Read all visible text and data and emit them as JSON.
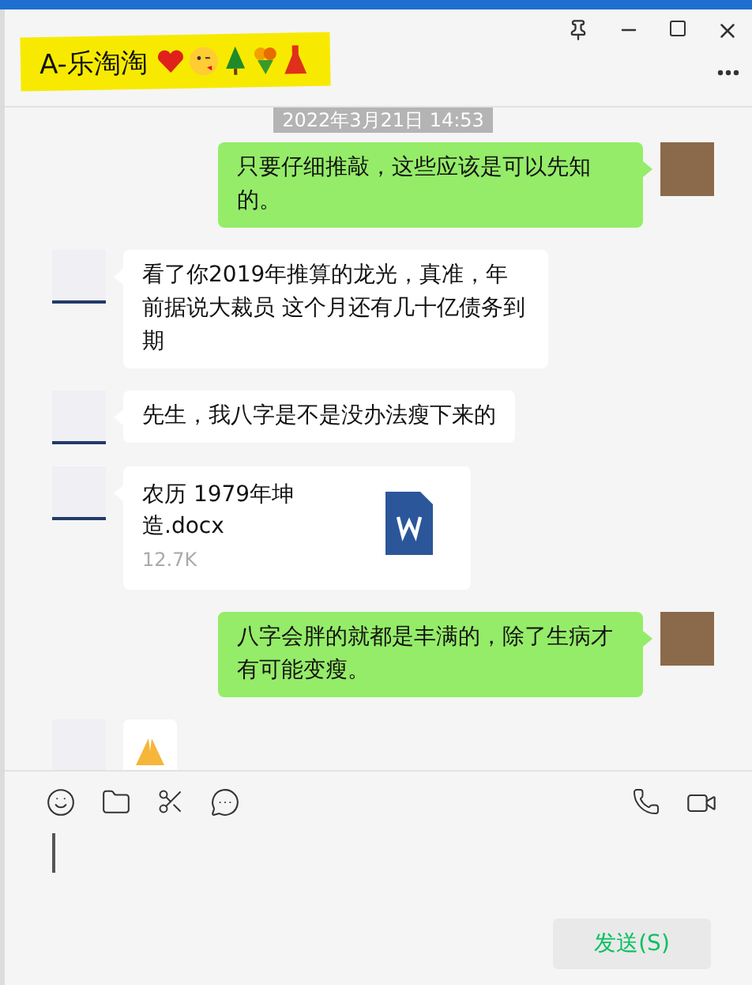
{
  "window": {
    "title": "A-乐淘淘"
  },
  "timestamp": "2022年3月21日 14:53",
  "messages": [
    {
      "kind": "text",
      "outgoing": true,
      "text": "只要仔细推敲，这些应该是可以先知的。"
    },
    {
      "kind": "text",
      "outgoing": false,
      "text": "看了你2019年推算的龙光，真准，年前据说大裁员 这个月还有几十亿债务到期"
    },
    {
      "kind": "text",
      "outgoing": false,
      "text": "先生，我八字是不是没办法瘦下来的"
    },
    {
      "kind": "file",
      "outgoing": false,
      "file_name": "农历 1979年坤造.docx",
      "size": "12.7K"
    },
    {
      "kind": "text",
      "outgoing": true,
      "text": "八字会胖的就都是丰满的，除了生病才有可能变瘦。"
    },
    {
      "kind": "emoji",
      "outgoing": false
    }
  ],
  "send_button": "发送(S)"
}
